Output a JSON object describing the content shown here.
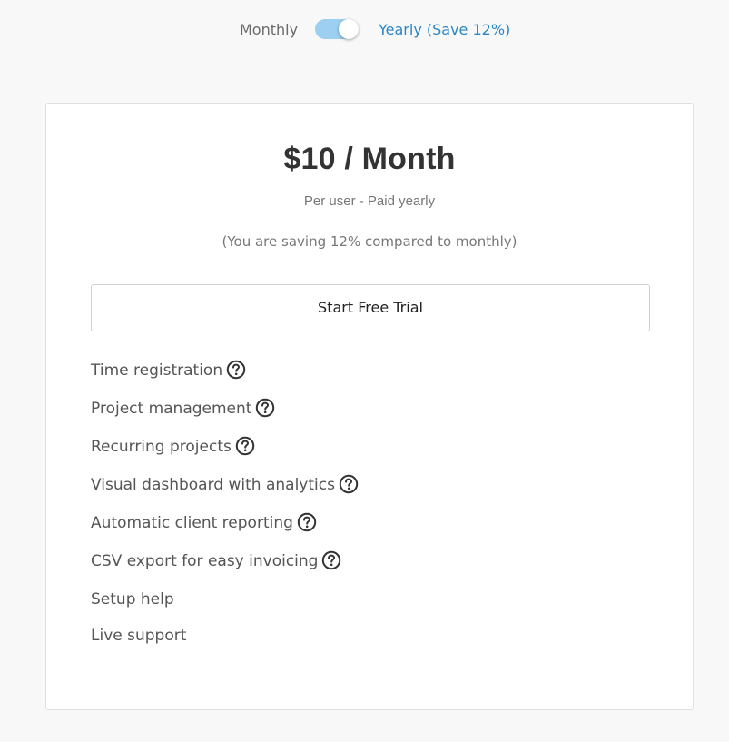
{
  "billing_toggle": {
    "monthly_label": "Monthly",
    "yearly_label": "Yearly (Save 12%)",
    "selected": "yearly"
  },
  "plan": {
    "price": "$10 / Month",
    "subtitle": "Per user - Paid yearly",
    "saving_note": "(You are saving 12% compared to monthly)",
    "cta_label": "Start Free Trial"
  },
  "features": [
    {
      "label": "Time registration",
      "help_icon": "question-circle-icon"
    },
    {
      "label": "Project management",
      "help_icon": "question-circle-icon"
    },
    {
      "label": "Recurring projects",
      "help_icon": "question-circle-icon"
    },
    {
      "label": "Visual dashboard with analytics",
      "help_icon": "question-circle-icon"
    },
    {
      "label": "Automatic client reporting",
      "help_icon": "question-circle-icon"
    },
    {
      "label": "CSV export for easy invoicing",
      "help_icon": "question-circle-icon"
    },
    {
      "label": "Setup help"
    },
    {
      "label": "Live support"
    }
  ],
  "colors": {
    "accent": "#2a86c6",
    "toggle_track": "#9ccff0",
    "background": "#f8f8f8"
  }
}
